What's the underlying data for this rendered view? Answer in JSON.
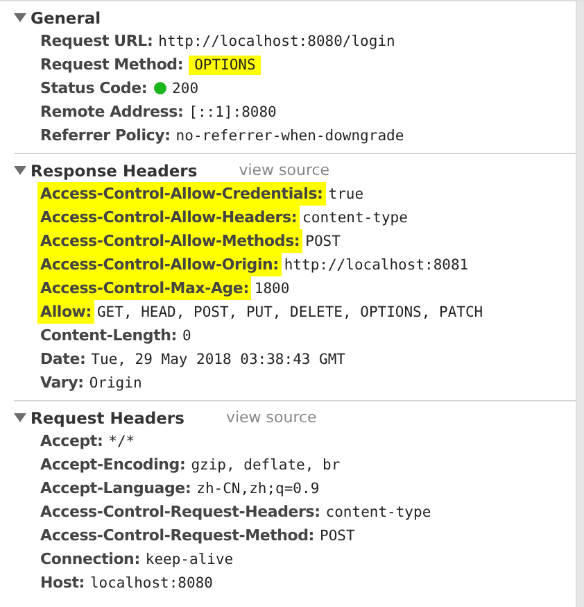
{
  "sections": [
    {
      "title": "General",
      "expanded": true,
      "rows": [
        {
          "key": "Request URL:",
          "value": "http://localhost:8080/login",
          "highlighted": false
        },
        {
          "key": "Request Method:",
          "value": "OPTIONS",
          "highlighted": false,
          "value_highlighted": true
        },
        {
          "key": "Status Code:",
          "value": "200",
          "highlighted": false,
          "kind": "status",
          "color": "#1db51d"
        },
        {
          "key": "Remote Address:",
          "value": "[::1]:8080",
          "highlighted": false
        },
        {
          "key": "Referrer Policy:",
          "value": "no-referrer-when-downgrade",
          "highlighted": false
        }
      ]
    },
    {
      "title": "Response Headers",
      "expanded": true,
      "link": "view source",
      "rows": [
        {
          "key": "Access-Control-Allow-Credentials:",
          "value": "true",
          "highlighted": true
        },
        {
          "key": "Access-Control-Allow-Headers:",
          "value": "content-type",
          "highlighted": true
        },
        {
          "key": "Access-Control-Allow-Methods:",
          "value": "POST",
          "highlighted": true
        },
        {
          "key": "Access-Control-Allow-Origin:",
          "value": "http://localhost:8081",
          "highlighted": true
        },
        {
          "key": "Access-Control-Max-Age:",
          "value": "1800",
          "highlighted": true
        },
        {
          "key": "Allow:",
          "value": "GET, HEAD, POST, PUT, DELETE, OPTIONS, PATCH",
          "highlighted": true
        },
        {
          "key": "Content-Length:",
          "value": "0",
          "highlighted": false
        },
        {
          "key": "Date:",
          "value": "Tue, 29 May 2018 03:38:43 GMT",
          "highlighted": false
        },
        {
          "key": "Vary:",
          "value": "Origin",
          "highlighted": false
        }
      ]
    },
    {
      "title": "Request Headers",
      "expanded": true,
      "link": "view source",
      "rows": [
        {
          "key": "Accept:",
          "value": "*/*",
          "highlighted": false
        },
        {
          "key": "Accept-Encoding:",
          "value": "gzip, deflate, br",
          "highlighted": false
        },
        {
          "key": "Accept-Language:",
          "value": "zh-CN,zh;q=0.9",
          "highlighted": false
        },
        {
          "key": "Access-Control-Request-Headers:",
          "value": "content-type",
          "highlighted": false
        },
        {
          "key": "Access-Control-Request-Method:",
          "value": "POST",
          "highlighted": false
        },
        {
          "key": "Connection:",
          "value": "keep-alive",
          "highlighted": false
        },
        {
          "key": "Host:",
          "value": "localhost:8080",
          "highlighted": false
        }
      ]
    }
  ]
}
